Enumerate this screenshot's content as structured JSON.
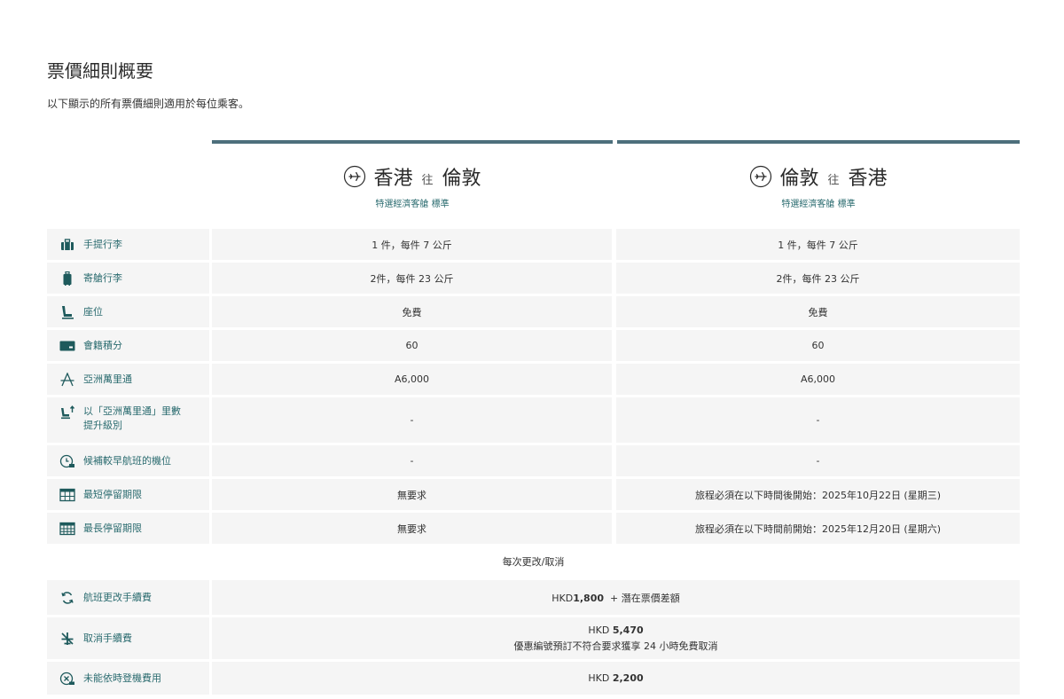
{
  "header": {
    "title": "票價細則概要",
    "subtitle": "以下顯示的所有票價細則適用於每位乘客。"
  },
  "routes": [
    {
      "from": "香港",
      "connector": "往",
      "to": "倫敦",
      "fare_class": "特選經濟客艙 標準"
    },
    {
      "from": "倫敦",
      "connector": "往",
      "to": "香港",
      "fare_class": "特選經濟客艙 標準"
    }
  ],
  "rows": [
    {
      "label": "手提行李",
      "icon": "carry-on-bag-icon",
      "out": "1 件，每件 7 公斤",
      "ret": "1 件，每件 7 公斤"
    },
    {
      "label": "寄艙行李",
      "icon": "checked-bag-icon",
      "out": "2件，每件 23 公斤",
      "ret": "2件，每件 23 公斤"
    },
    {
      "label": "座位",
      "icon": "seat-icon",
      "out": "免費",
      "ret": "免費"
    },
    {
      "label": "會籍積分",
      "icon": "status-points-icon",
      "out": "60",
      "ret": "60"
    },
    {
      "label": "亞洲萬里通",
      "icon": "asia-miles-icon",
      "out": "A6,000",
      "ret": "A6,000"
    },
    {
      "label": "以「亞洲萬里通」里數提升級別",
      "icon": "upgrade-seat-icon",
      "out": "-",
      "ret": "-"
    },
    {
      "label": "候補較早航班的機位",
      "icon": "standby-icon",
      "out": "-",
      "ret": "-"
    },
    {
      "label": "最短停留期限",
      "icon": "calendar-min-icon",
      "out": "無要求",
      "ret": "旅程必須在以下時間後開始：2025年10月22日 (星期三)"
    },
    {
      "label": "最長停留期限",
      "icon": "calendar-max-icon",
      "out": "無要求",
      "ret": "旅程必須在以下時間前開始：2025年12月20日 (星期六)"
    }
  ],
  "change_section": {
    "heading": "每次更改/取消",
    "rows": [
      {
        "label": "航班更改手續費",
        "icon": "change-flight-icon",
        "currency": "HKD",
        "amount": "1,800",
        "note": "+ 潛在票價差額"
      },
      {
        "label": "取消手續費",
        "icon": "cancel-flight-icon",
        "currency": "HKD",
        "amount": "5,470",
        "note": "優惠編號預訂不符合要求獲享 24 小時免費取消"
      },
      {
        "label": "未能依時登機費用",
        "icon": "no-show-icon",
        "currency": "HKD",
        "amount": "2,200",
        "note": ""
      }
    ]
  },
  "colors": {
    "accent_bar": "#4d6f7c",
    "label_text": "#2a6b6f",
    "row_bg": "#f5f5f5",
    "icon": "#1e5a5c"
  }
}
